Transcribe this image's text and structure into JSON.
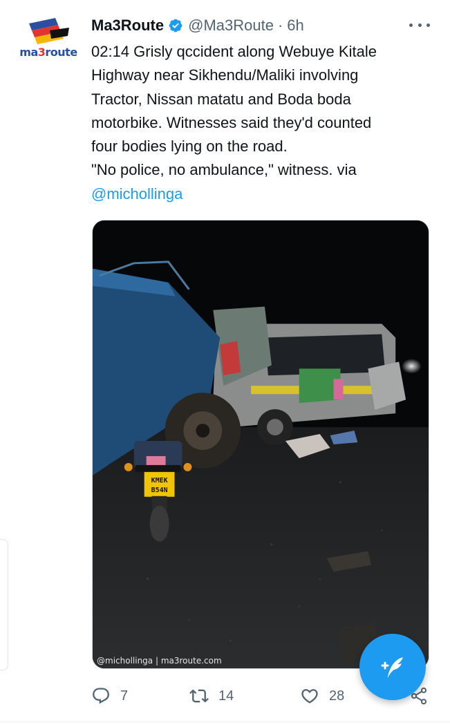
{
  "tweet": {
    "display_name": "Ma3Route",
    "handle": "@Ma3Route",
    "separator": "·",
    "time": "6h",
    "avatar_text_a": "ma",
    "avatar_text_b": "3",
    "avatar_text_c": "route",
    "text_lines": [
      "02:14 Grisly qccident along Webuye Kitale",
      "Highway near Sikhendu/Maliki involving",
      "Tractor, Nissan matatu and Boda boda",
      "motorbike. Witnesses said they'd counted",
      "four bodies lying on the road.",
      "\"No police, no ambulance,\" witness.   via"
    ],
    "mention": "@michollinga",
    "media_watermark": "@michollinga | ma3route.com",
    "plate_line1": "KMEK",
    "plate_line2": "B54N"
  },
  "actions": {
    "reply_count": "7",
    "retweet_count": "14",
    "like_count": "28"
  },
  "icons": {
    "verified": "verified-badge-icon",
    "more": "more-options-icon",
    "reply": "reply-icon",
    "retweet": "retweet-icon",
    "like": "heart-icon",
    "share": "share-icon",
    "compose": "compose-tweet-icon"
  },
  "colors": {
    "accent": "#1d9bf0",
    "text_primary": "#0f1419",
    "text_secondary": "#536471"
  }
}
